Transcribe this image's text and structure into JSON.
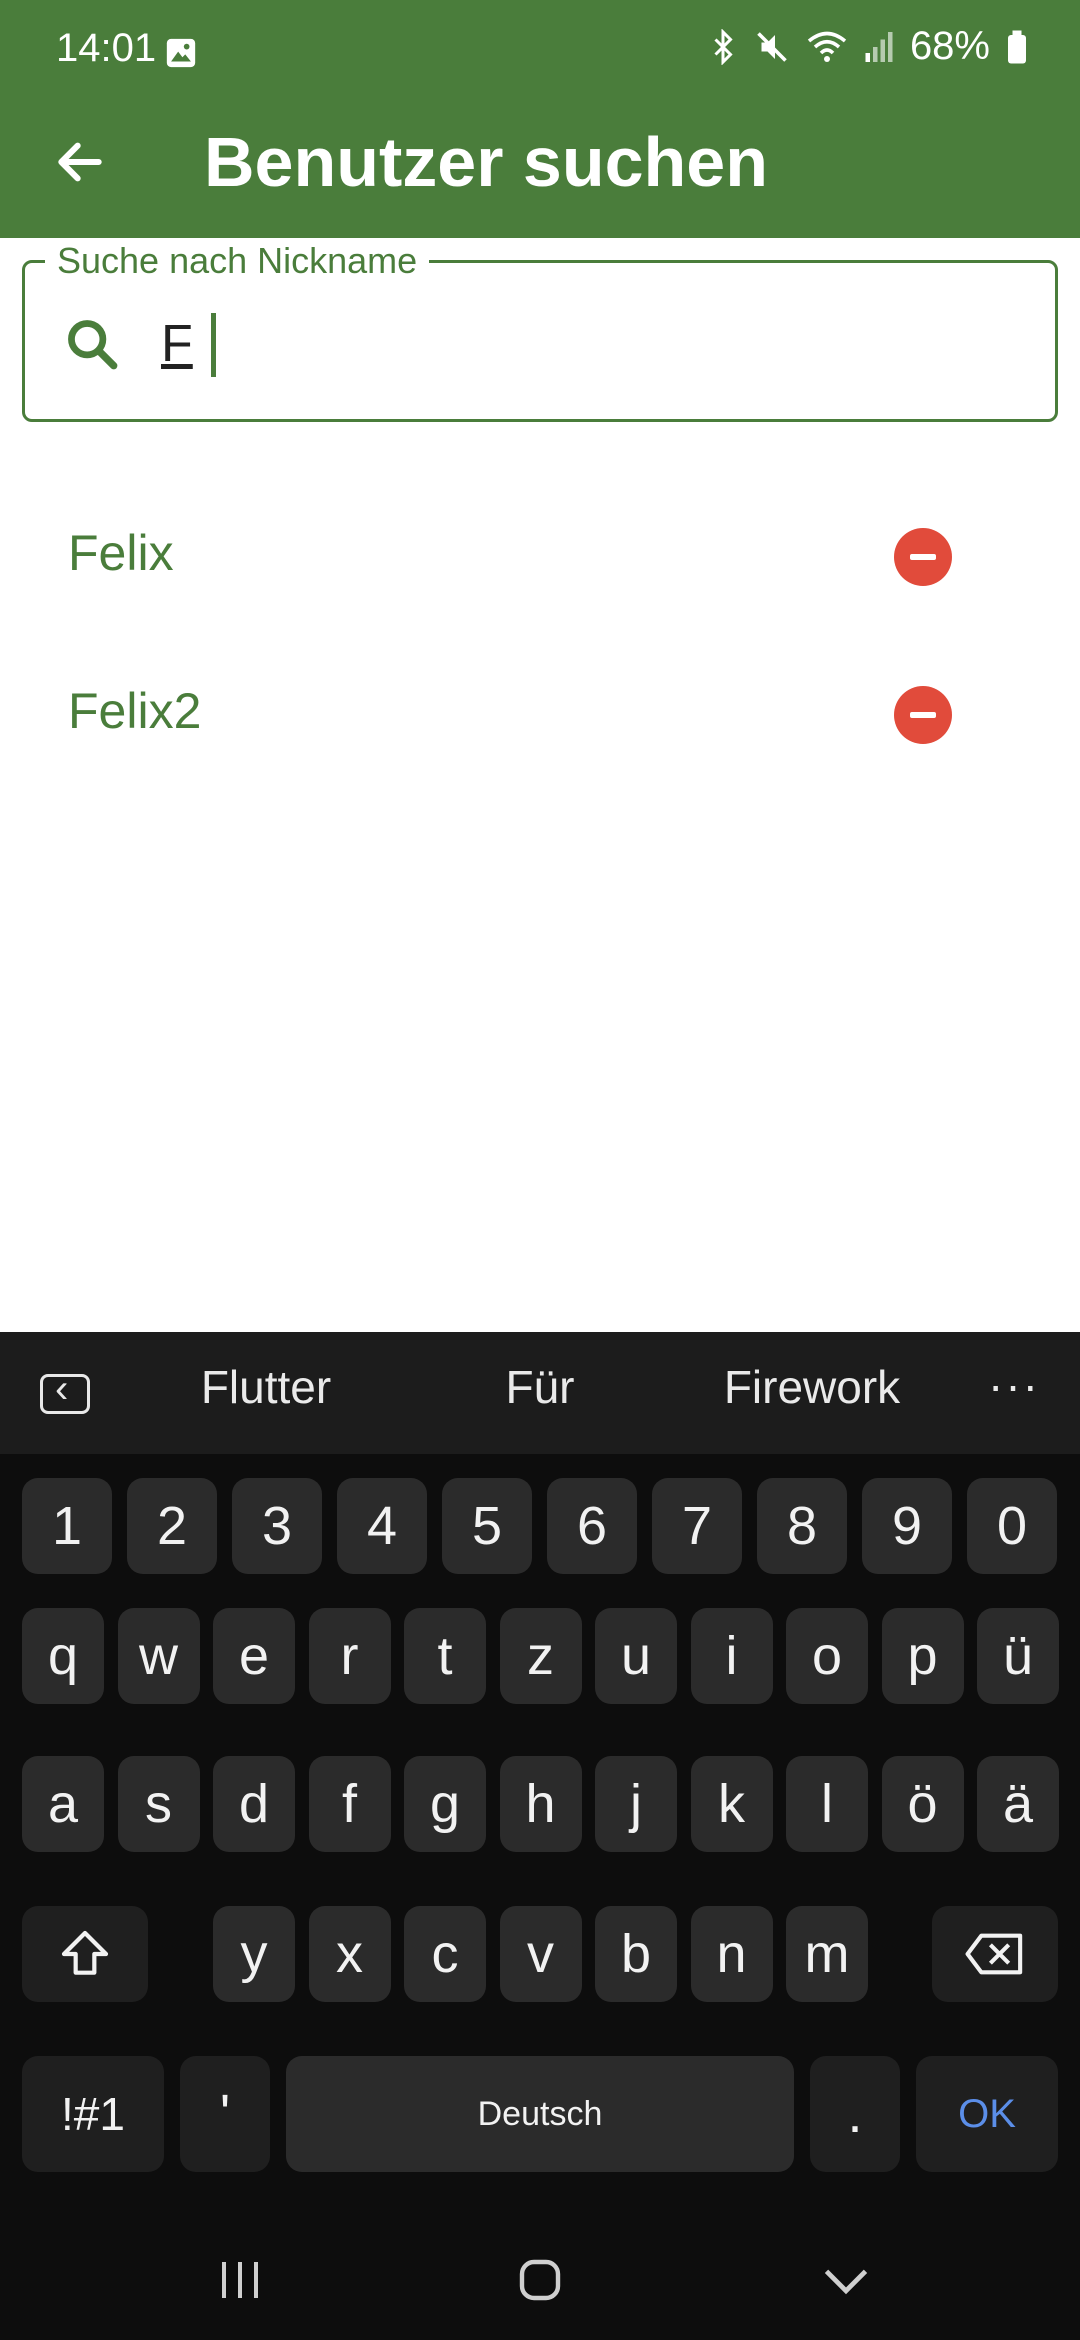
{
  "status_bar": {
    "time": "14:01",
    "battery": "68%"
  },
  "app_bar": {
    "title": "Benutzer suchen"
  },
  "search": {
    "label": "Suche nach Nickname",
    "value": "F"
  },
  "results": [
    {
      "name": "Felix"
    },
    {
      "name": "Felix2"
    }
  ],
  "keyboard": {
    "suggestions": [
      "Flutter",
      "Für",
      "Firework"
    ],
    "more": "···",
    "row_numbers": [
      "1",
      "2",
      "3",
      "4",
      "5",
      "6",
      "7",
      "8",
      "9",
      "0"
    ],
    "row_1": [
      "q",
      "w",
      "e",
      "r",
      "t",
      "z",
      "u",
      "i",
      "o",
      "p",
      "ü"
    ],
    "row_2": [
      "a",
      "s",
      "d",
      "f",
      "g",
      "h",
      "j",
      "k",
      "l",
      "ö",
      "ä"
    ],
    "row_3": [
      "y",
      "x",
      "c",
      "v",
      "b",
      "n",
      "m"
    ],
    "symbols_key": "!#1",
    "apostrophe_key": "'",
    "space_label": "Deutsch",
    "period_key": ".",
    "ok_key": "OK"
  },
  "colors": {
    "primary": "#4a7d3b",
    "remove": "#e14b3b",
    "ok": "#5b8ee8"
  }
}
